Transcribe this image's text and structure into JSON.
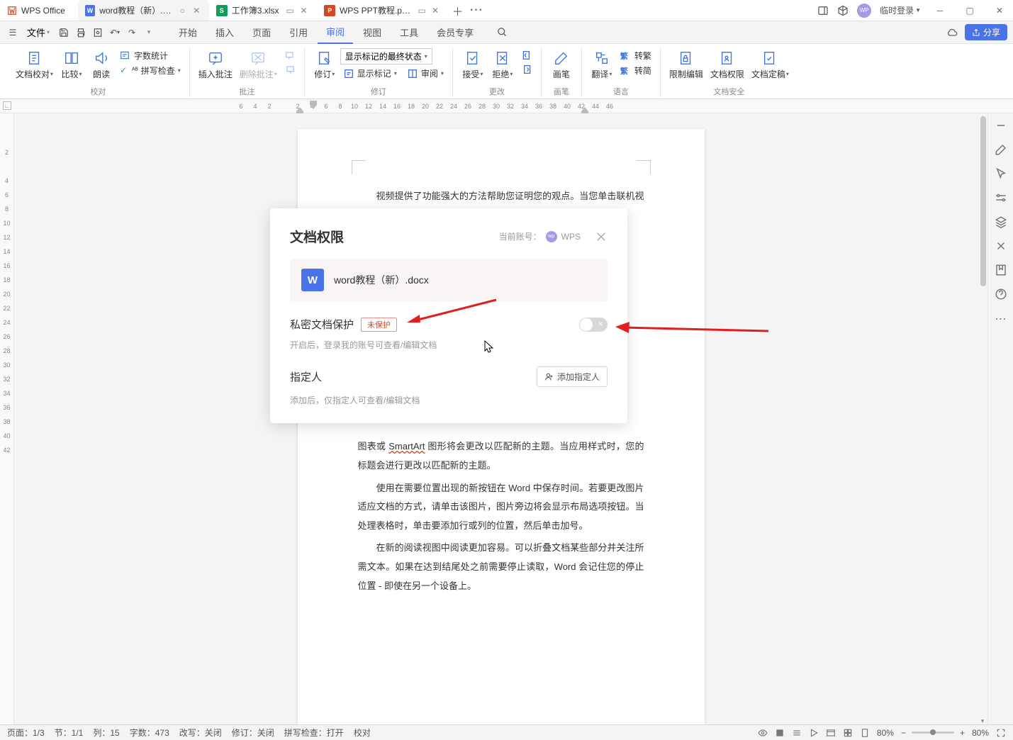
{
  "brand": "WPS Office",
  "tabs": [
    {
      "label": "word教程（新）.docx",
      "type": "W",
      "active": true
    },
    {
      "label": "工作簿3.xlsx",
      "type": "S",
      "active": false
    },
    {
      "label": "WPS PPT教程.pptx",
      "type": "P",
      "active": false
    }
  ],
  "login_label": "临时登录",
  "file_menu": "文件",
  "menus": [
    "开始",
    "插入",
    "页面",
    "引用",
    "审阅",
    "视图",
    "工具",
    "会员专享"
  ],
  "active_menu": "审阅",
  "share_btn": "分享",
  "ribbon": {
    "grp1": {
      "proof": "文档校对",
      "compare": "比较",
      "label": "校对",
      "read": "朗读",
      "wordcount": "字数统计",
      "spell": "拼写检查"
    },
    "grp2": {
      "insert": "插入批注",
      "delete": "删除批注",
      "label": "批注"
    },
    "grp3": {
      "track": "修订",
      "dropdown": "显示标记的最终状态",
      "showmark": "显示标记",
      "pane": "审阅",
      "label": "修订"
    },
    "grp4": {
      "accept": "接受",
      "reject": "拒绝",
      "label": "更改"
    },
    "grp5": {
      "pen": "画笔",
      "label": "画笔"
    },
    "grp6": {
      "translate": "翻译",
      "sc": "转繁",
      "tc": "转简",
      "label": "语言",
      "sticon": "繁",
      "tcicon": "繁"
    },
    "grp7": {
      "restrict": "限制编辑",
      "perm": "文档权限",
      "final": "文档定稿",
      "label": "文档安全"
    }
  },
  "ruler_h": [
    "6",
    "4",
    "2",
    "",
    "2",
    "4",
    "6",
    "8",
    "10",
    "12",
    "14",
    "16",
    "18",
    "20",
    "22",
    "24",
    "26",
    "28",
    "30",
    "32",
    "34",
    "36",
    "38",
    "40",
    "42",
    "44",
    "46"
  ],
  "ruler_v": [
    "",
    "2",
    "",
    "4",
    "6",
    "8",
    "10",
    "12",
    "14",
    "16",
    "18",
    "20",
    "22",
    "24",
    "26",
    "28",
    "30",
    "32",
    "34",
    "36",
    "38",
    "40",
    "42"
  ],
  "doc": {
    "p1": "视频提供了功能强大的方法帮助您证明您的观点。当您单击联机视频时，可",
    "p2pre": "图表或 ",
    "smart": "SmartArt",
    "p2post": " 图形将会更改以匹配新的主题。当应用样式时，您的标题会进行更改以匹配新的主题。",
    "p3": "使用在需要位置出现的新按钮在 Word 中保存时间。若要更改图片适应文档的方式，请单击该图片，图片旁边将会显示布局选项按钮。当处理表格时，单击要添加行或列的位置，然后单击加号。",
    "p4": "在新的阅读视图中阅读更加容易。可以折叠文档某些部分并关注所需文本。如果在达到结尾处之前需要停止读取，Word 会记住您的停止位置 - 即使在另一个设备上。"
  },
  "dialog": {
    "title": "文档权限",
    "acct_label": "当前账号：",
    "acct_name": "WPS",
    "file": "word教程（新）.docx",
    "sec1": "私密文档保护",
    "badge": "未保护",
    "sec1_desc": "开启后，登录我的账号可查看/编辑文档",
    "sec2": "指定人",
    "sec2_desc": "添加后，仅指定人可查看/编辑文档",
    "add_btn": "添加指定人"
  },
  "status": {
    "page": "页面：1/3",
    "section": "节：1/1",
    "col": "列：15",
    "words": "字数：473",
    "rev": "改写：关闭",
    "track": "修订：关闭",
    "spell": "拼写检查：打开",
    "proof": "校对",
    "zoom1": "80%",
    "zoom2": "80%"
  }
}
